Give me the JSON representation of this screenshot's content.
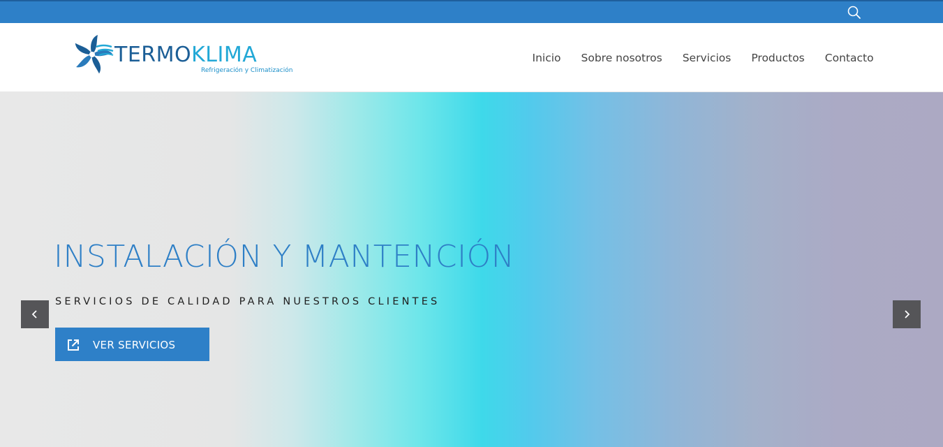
{
  "topbar": {
    "icon": "search-icon",
    "color": "#2e80c8"
  },
  "logo": {
    "word_part1": "TERMO",
    "word_part2": "KLIMA",
    "tagline": "Refrigeración y Climatización",
    "icon": "fan-icon",
    "colors": {
      "dark": "#1b5e96",
      "light": "#22a8d6"
    }
  },
  "nav": {
    "items": [
      {
        "label": "Inicio"
      },
      {
        "label": "Sobre nosotros"
      },
      {
        "label": "Servicios"
      },
      {
        "label": "Productos"
      },
      {
        "label": "Contacto"
      }
    ]
  },
  "hero": {
    "title": "INSTALACIÓN Y MANTENCIÓN",
    "subtitle": "SERVICIOS DE CALIDAD PARA NUESTROS CLIENTES",
    "button": {
      "label": "VER SERVICIOS",
      "icon": "external-link-icon"
    },
    "prev_icon": "chevron-left-icon",
    "next_icon": "chevron-right-icon",
    "accent": "#2e7fc6"
  }
}
